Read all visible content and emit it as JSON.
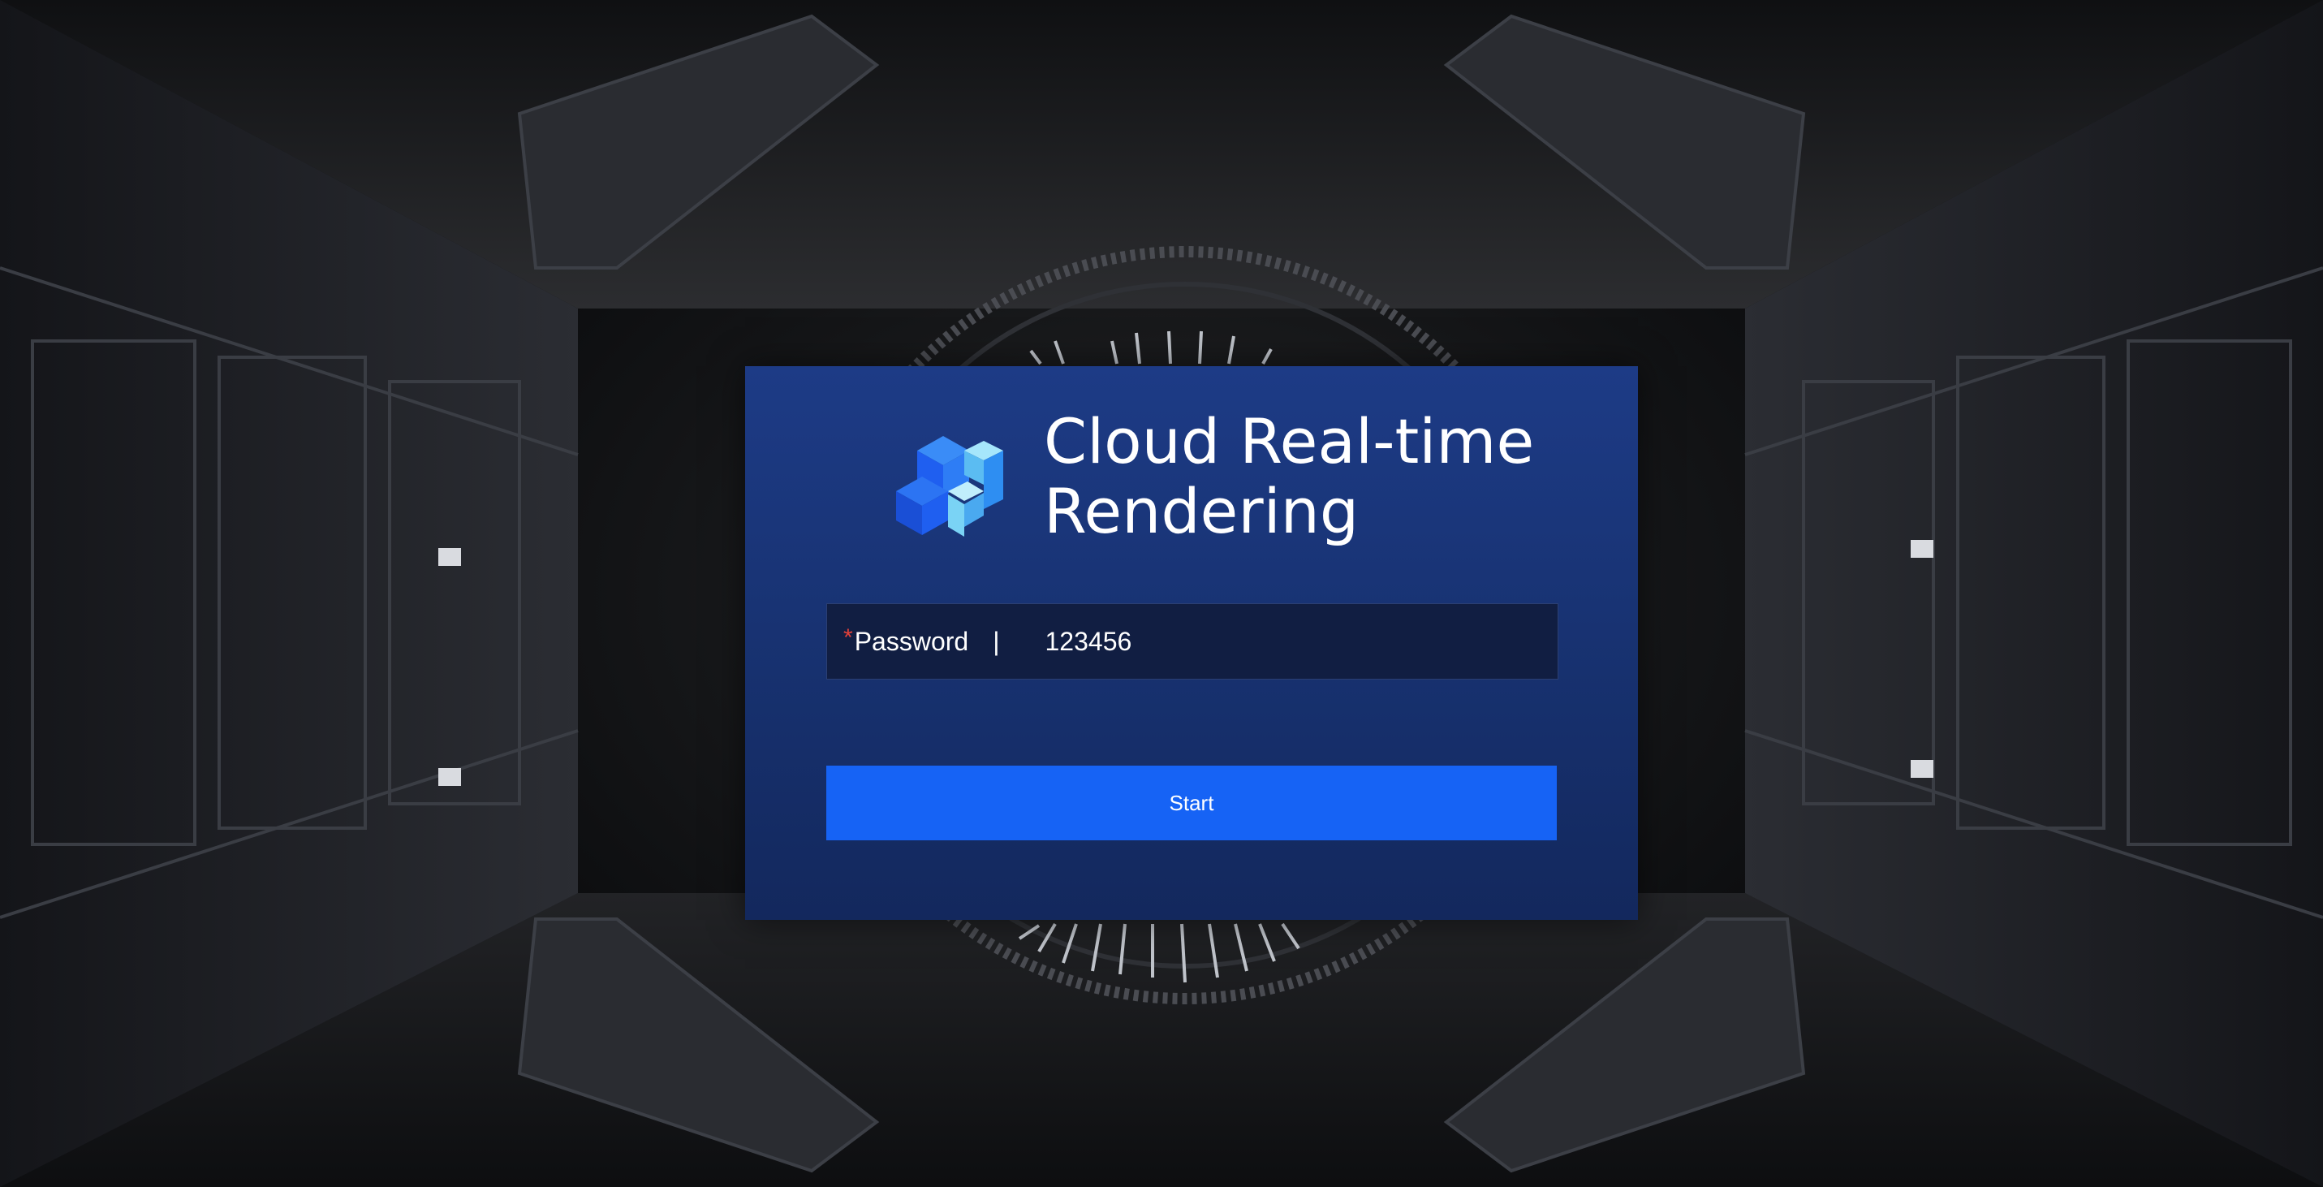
{
  "app": {
    "title_line1": "Cloud Real-time",
    "title_line2": "Rendering",
    "logo_icon": "cube-logo-icon"
  },
  "login": {
    "password_required_mark": "*",
    "password_label": "Password",
    "separator": "|",
    "password_value": "123456",
    "start_label": "Start"
  },
  "colors": {
    "panel": "#1d3b86",
    "input_bg": "#111e42",
    "button": "#1663f5",
    "required": "#e0413a",
    "logo_dark": "#1f5ff0",
    "logo_light": "#7ad3f5"
  }
}
